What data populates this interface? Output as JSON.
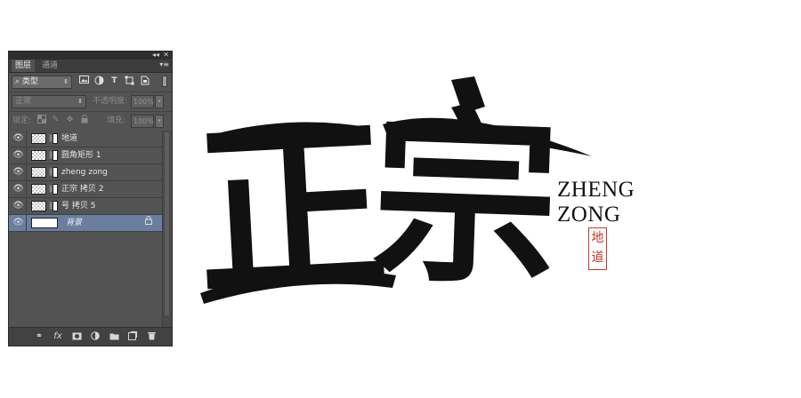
{
  "panel": {
    "tabs": [
      {
        "label": "图层",
        "active": true
      },
      {
        "label": "通道",
        "active": false
      }
    ],
    "filter": {
      "selected": "类型",
      "icons": [
        "image-filter-icon",
        "adjustment-filter-icon",
        "type-filter-icon",
        "shape-filter-icon",
        "smart-object-filter-icon"
      ],
      "type_glyph": "T"
    },
    "blend": {
      "mode": "正常",
      "opacity_label": "不透明度:",
      "opacity_value": "100%"
    },
    "lock": {
      "label": "锁定:",
      "fill_label": "填充:",
      "fill_value": "100%"
    },
    "layers": [
      {
        "name": "地道",
        "selected": false,
        "locked": false
      },
      {
        "name": "圆角矩形 1",
        "selected": false,
        "locked": false
      },
      {
        "name": "zheng zong",
        "selected": false,
        "locked": false
      },
      {
        "name": "正宗 拷贝 2",
        "selected": false,
        "locked": false
      },
      {
        "name": "号 拷贝 5",
        "selected": false,
        "locked": false
      },
      {
        "name": "背景",
        "selected": true,
        "locked": true
      }
    ],
    "bottom_icons": [
      "link-icon",
      "fx-icon",
      "mask-icon",
      "adjustment-icon",
      "folder-icon",
      "new-layer-icon",
      "trash-icon"
    ],
    "fx_label": "fx"
  },
  "artwork": {
    "calligraphy": [
      "正",
      "宗"
    ],
    "latin_lines": [
      "ZHENG",
      "ZONG"
    ],
    "seal_chars": [
      "地",
      "道"
    ],
    "ink_color": "#111111",
    "seal_color": "#c0392b"
  },
  "colors": {
    "panel_bg": "#535353",
    "selected_layer": "#6a7fa0"
  }
}
